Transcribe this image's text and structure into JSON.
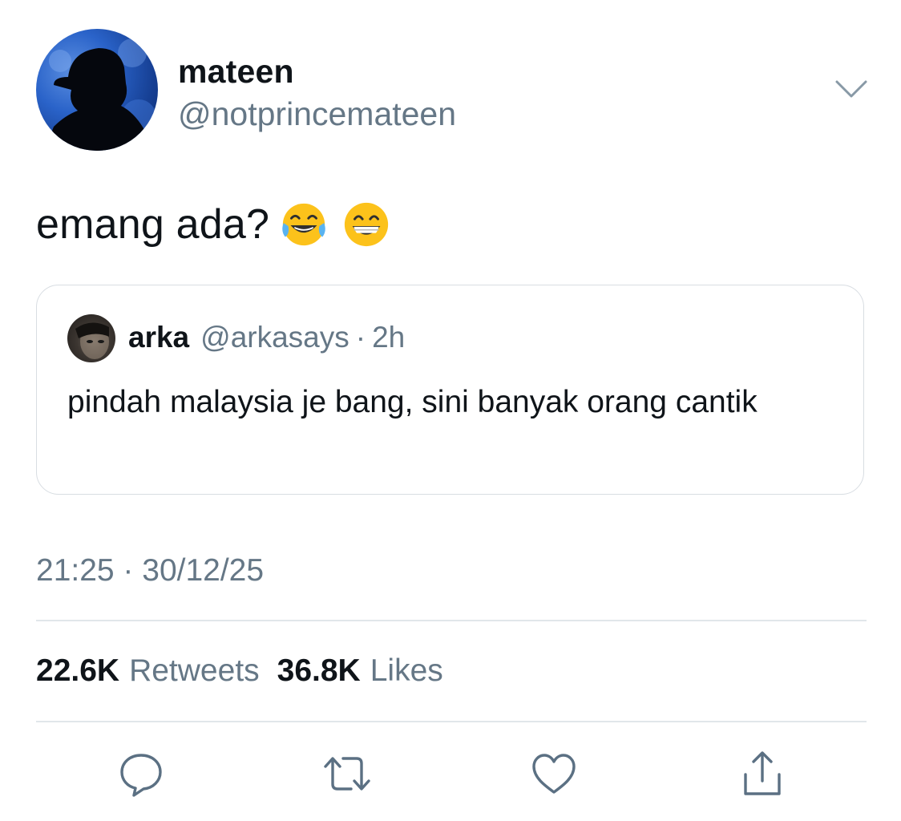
{
  "author": {
    "name": "mateen",
    "handle": "@notprincemateen"
  },
  "tweet": {
    "text": "emang ada?",
    "emojis": [
      "face-with-tears-of-joy",
      "grinning-face-with-smiling-eyes"
    ]
  },
  "quoted_tweet": {
    "name": "arka",
    "handle": "@arkasays",
    "separator": "·",
    "time": "2h",
    "text": "pindah malaysia je bang, sini banyak orang cantik"
  },
  "timestamp": "21:25 · 30/12/25",
  "stats": {
    "retweets_count": "22.6K",
    "retweets_label": "Retweets",
    "likes_count": "36.8K",
    "likes_label": "Likes"
  },
  "actions": [
    "reply-icon",
    "retweet-icon",
    "like-icon",
    "share-icon"
  ],
  "colors": {
    "text_primary": "#0f1419",
    "text_secondary": "#657786",
    "border": "#d8dde2",
    "icon": "#5b7083"
  }
}
